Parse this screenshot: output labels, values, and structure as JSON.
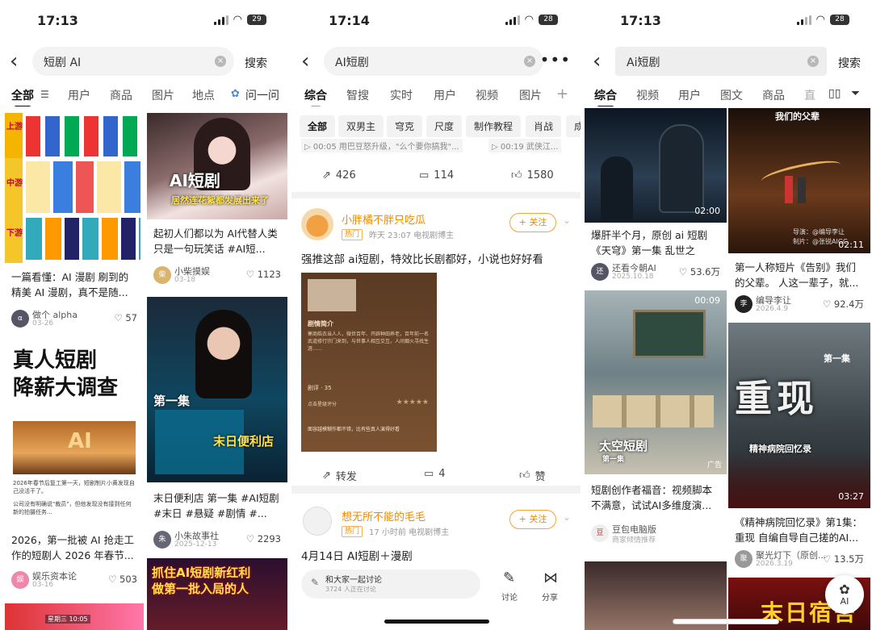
{
  "screens": [
    {
      "time": "17:13",
      "battery": "29",
      "search": {
        "query": "短剧 AI",
        "button": "搜索"
      },
      "tabs": [
        "全部",
        "用户",
        "商品",
        "图片",
        "地点",
        "问一问"
      ],
      "left_cards": [
        {
          "title": "一篇看懂：AI 漫剧 刷到的精美 AI 漫剧，真不是随...",
          "author": "做个 alpha",
          "date": "03-26",
          "likes": "57",
          "image_labels": [
            "上游",
            "中游",
            "下游"
          ]
        },
        {
          "headline": "真人短剧\n降薪大调查",
          "caption": "2026年春节后复工第一天，短剧制片小黄发现自己没活干了。",
          "caption2": "公司没有明确说\"裁员\"，但他发现没有接到任何新的拍摄任务...",
          "title": "2026，第一批被 AI 抢走工作的短剧人 2026 年春节...",
          "author": "娱乐资本论",
          "date": "03-16",
          "likes": "503",
          "bottom_tag": "星期三 10:05"
        }
      ],
      "right_cards": [
        {
          "overlay": "AI短剧",
          "overlay2": "居然连花絮都发展出来了",
          "title": "起初人们都以为 AI代替人类只是一句玩笑话 #AI短...",
          "author": "小柴摸娱",
          "date": "03-18",
          "likes": "1123"
        },
        {
          "overlay": "第一集",
          "overlay2": "末日便利店",
          "title": "末日便利店 第一集 #AI短剧 #末日 #悬疑 #剧情 #...",
          "author": "小朱故事社",
          "date": "2025-12-13",
          "likes": "2293"
        },
        {
          "overlay": "抓住AI短剧新红利\n做第一批入局的人"
        }
      ]
    },
    {
      "time": "17:14",
      "battery": "28",
      "search": {
        "query": "AI短剧"
      },
      "tabs": [
        "综合",
        "智搜",
        "实时",
        "用户",
        "视频",
        "图片"
      ],
      "chips": [
        "全部",
        "双男主",
        "穹克",
        "尺度",
        "制作教程",
        "肖战",
        "成"
      ],
      "top_actions": {
        "share": "426",
        "comment": "114",
        "like": "1580"
      },
      "top_snippet_left": "▷ 00:05 用巴豆怒升级，\"么个要你搞我\"...",
      "top_snippet_right": "▷ 00:19 武侠江...",
      "posts": [
        {
          "name": "小胖橘不胖只吃瓜",
          "badge": "热门",
          "time": "昨天 23:07  电视剧博主",
          "follow": "+ 关注",
          "text": "强推这部 ai短剧，特效比长剧都好，小说也好好看",
          "img_title": "剧情简介",
          "img_text": "寒商皓衣当人人，微世百年、开辟种田养老，百年前一名武道修行宗门来到，与世事人相互交互，人间烟火寻找生涯……",
          "img_count": "剧评 · 35",
          "img_rate": "点击星级评分",
          "img_comment": "面容越模糊作都不错，比有些真人演得好看",
          "share": "转发",
          "comment": "4",
          "like": "赞"
        },
        {
          "name": "想无所不能的毛毛",
          "badge": "热门",
          "time": "17 小时前  电视剧博主",
          "follow": "+ 关注",
          "text": "4月14日    AI短剧＋漫剧"
        }
      ],
      "discuss": {
        "title": "和大家一起讨论",
        "sub": "3724 人正在讨论",
        "comment": "讨论",
        "share": "分享"
      }
    },
    {
      "time": "17:13",
      "battery": "28",
      "search": {
        "query": "Ai短剧",
        "button": "搜索"
      },
      "tabs": [
        "综合",
        "视频",
        "用户",
        "图文",
        "商品",
        "直"
      ],
      "left_cards": [
        {
          "duration": "02:00",
          "title": "爆肝半个月，原创 ai 短剧《天穹》第一集 乱世之中，...",
          "author": "还看今朝AI",
          "date": "2025.10.18",
          "likes": "53.6万"
        },
        {
          "duration": "00:09",
          "overlay": "太空短剧",
          "overlay2": "第一集",
          "ad": "广告",
          "title": "短剧创作者福音：视频脚本不满意，试试AI多维度演...",
          "author": "豆包电脑版",
          "date": "商家倾情推荐"
        }
      ],
      "right_cards": [
        {
          "overlay": "我们的父辈",
          "credit1": "导演：@编导李让",
          "credit2": "制片：@张锐AIGC",
          "duration": "02:11",
          "title": "第一人称短片《告别》我们的父辈。 人这一辈子，就...",
          "author": "编导李让",
          "date": "2026.4.9",
          "likes": "92.4万"
        },
        {
          "overlay": "重现",
          "overlay2": "精神病院回忆录",
          "overlay3": "第一集",
          "duration": "03:27",
          "title": "《精神病院回忆录》第1集：重现 自编自导自己搓的AI...",
          "author": "聚光灯下（原创...",
          "date": "2026.3.19",
          "likes": "13.5万"
        },
        {
          "overlay": "末日宿舍"
        }
      ],
      "fab": "AI"
    }
  ]
}
